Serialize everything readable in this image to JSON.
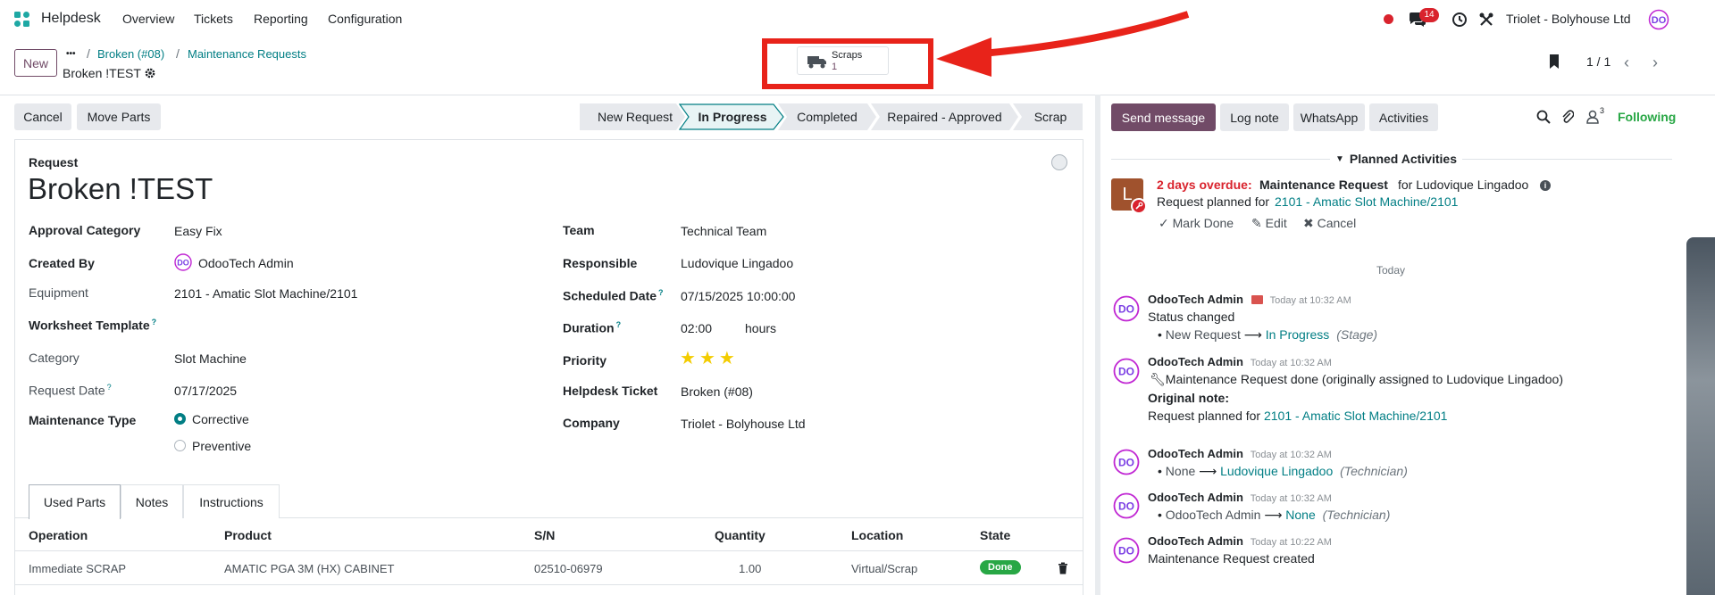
{
  "app": {
    "name": "Helpdesk",
    "menu": [
      "Overview",
      "Tickets",
      "Reporting",
      "Configuration"
    ]
  },
  "systray": {
    "chat_count": "14",
    "company": "Triolet - Bolyhouse Ltd"
  },
  "control": {
    "new_label": "New",
    "more_label": "•••",
    "breadcrumb": [
      "Broken (#08)",
      "Maintenance Requests"
    ],
    "record_title": "Broken !TEST",
    "pager": "1 / 1"
  },
  "smart_button": {
    "label": "Scraps",
    "count": "1"
  },
  "actions": {
    "cancel": "Cancel",
    "move_parts": "Move Parts"
  },
  "stages": [
    "New Request",
    "In Progress",
    "Completed",
    "Repaired - Approved",
    "Scrap"
  ],
  "active_stage": "In Progress",
  "form": {
    "request_label": "Request",
    "title": "Broken !TEST",
    "left": [
      {
        "label": "Approval Category",
        "value": "Easy Fix"
      },
      {
        "label": "Created By",
        "value": "OdooTech Admin"
      },
      {
        "label": "Equipment",
        "value": "2101 - Amatic Slot Machine/2101"
      },
      {
        "label": "Worksheet Template",
        "value": ""
      },
      {
        "label": "Category",
        "value": "Slot Machine"
      },
      {
        "label": "Request Date",
        "value": "07/17/2025"
      },
      {
        "label": "Maintenance Type",
        "options": [
          "Corrective",
          "Preventive"
        ],
        "selected": "Corrective"
      }
    ],
    "right": [
      {
        "label": "Team",
        "value": "Technical Team"
      },
      {
        "label": "Responsible",
        "value": "Ludovique Lingadoo"
      },
      {
        "label": "Scheduled Date",
        "value": "07/15/2025 10:00:00"
      },
      {
        "label": "Duration",
        "value": "02:00",
        "unit": "hours"
      },
      {
        "label": "Priority",
        "stars": 3,
        "max_stars": 3
      },
      {
        "label": "Helpdesk Ticket",
        "value": "Broken (#08)"
      },
      {
        "label": "Company",
        "value": "Triolet - Bolyhouse Ltd"
      }
    ],
    "help_marker": "?"
  },
  "tabs": [
    "Used Parts",
    "Notes",
    "Instructions"
  ],
  "parts_table": {
    "columns": [
      "Operation",
      "Product",
      "S/N",
      "Quantity",
      "Location",
      "State"
    ],
    "rows": [
      {
        "operation": "Immediate SCRAP",
        "product": "AMATIC PGA 3M (HX) CABINET",
        "sn": "02510-06979",
        "quantity": "1.00",
        "location": "Virtual/Scrap",
        "state": "Done"
      }
    ]
  },
  "chatter": {
    "send_message": "Send message",
    "log_note": "Log note",
    "whatsapp": "WhatsApp",
    "activities": "Activities",
    "followers_count": "3",
    "following": "Following",
    "planned_title": "Planned Activities",
    "activity": {
      "avatar_letter": "L",
      "overdue": "2 days overdue:",
      "type": "Maintenance Request",
      "for": "for Ludovique Lingadoo",
      "planned_prefix": "Request planned for",
      "planned_link": "2101 - Amatic Slot Machine/2101",
      "mark_done": "Mark Done",
      "edit": "Edit",
      "cancel": "Cancel"
    },
    "today_label": "Today",
    "messages": [
      {
        "author": "OdooTech Admin",
        "time": "Today at 10:32 AM",
        "line1": "Status changed",
        "from": "New Request",
        "to": "In Progress",
        "field": "(Stage)"
      },
      {
        "author": "OdooTech Admin",
        "time": "Today at 10:32 AM",
        "body": "Maintenance Request done (originally assigned to Ludovique Lingadoo)",
        "note_label": "Original note:",
        "note_prefix": "Request planned for",
        "note_link": "2101 - Amatic Slot Machine/2101"
      },
      {
        "author": "OdooTech Admin",
        "time": "Today at 10:32 AM",
        "from": "None",
        "to": "Ludovique Lingadoo",
        "field": "(Technician)"
      },
      {
        "author": "OdooTech Admin",
        "time": "Today at 10:32 AM",
        "from": "OdooTech Admin",
        "to": "None",
        "field": "(Technician)"
      },
      {
        "author": "OdooTech Admin",
        "time": "Today at 10:22 AM",
        "line1": "Maintenance Request created"
      }
    ]
  },
  "colors": {
    "brand": "#714b67",
    "accent": "#017e84",
    "annotation": "#e8231a",
    "overdue": "#d9232d",
    "done": "#28a745",
    "star": "#f3cc00"
  }
}
